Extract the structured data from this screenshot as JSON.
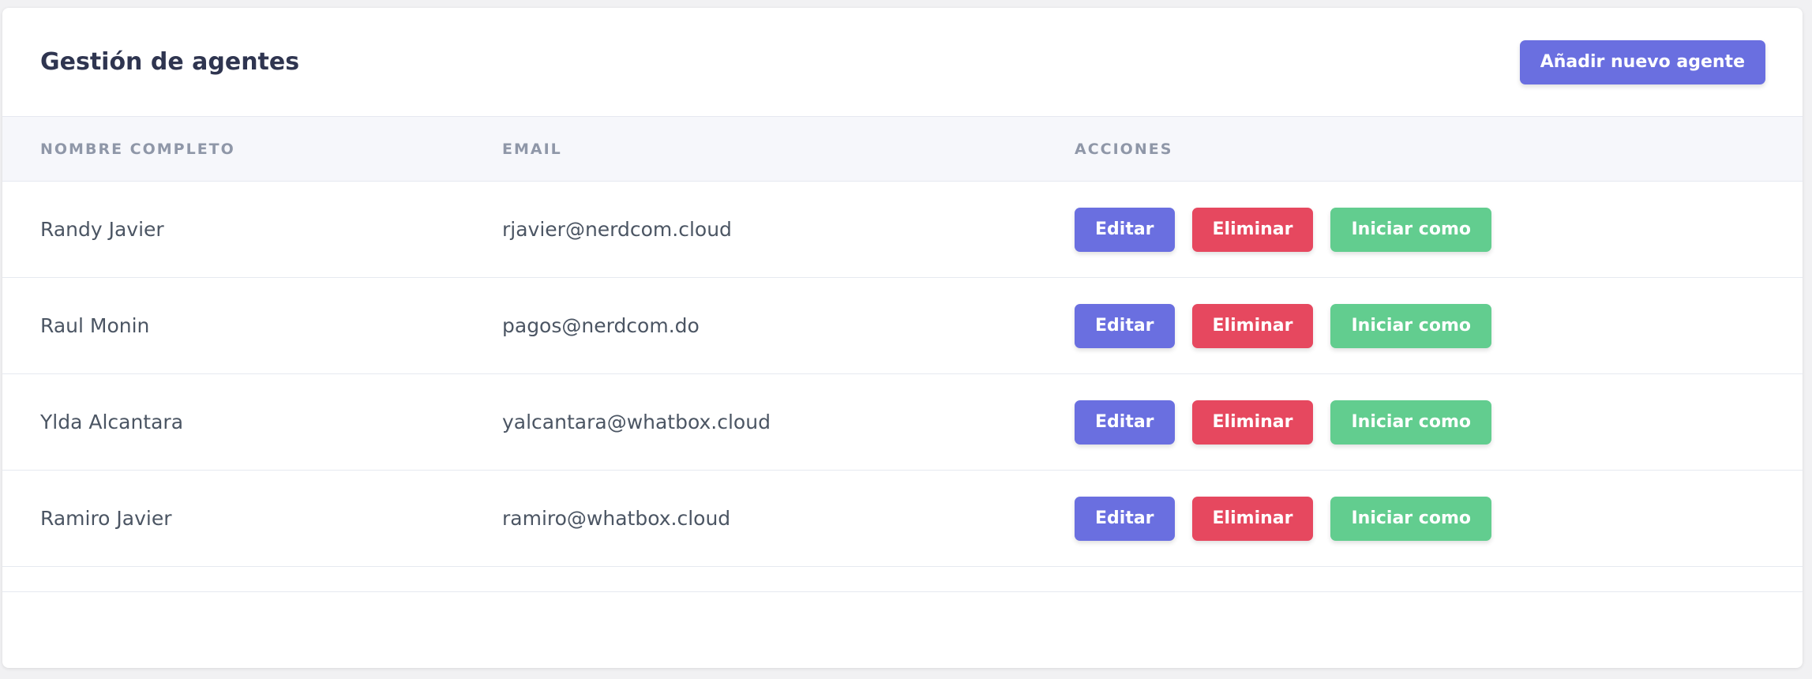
{
  "header": {
    "title": "Gestión de agentes",
    "add_button_label": "Añadir nuevo agente"
  },
  "table": {
    "columns": [
      "NOMBRE COMPLETO",
      "EMAIL",
      "ACCIONES"
    ],
    "rows": [
      {
        "name": "Randy Javier",
        "email": "rjavier@nerdcom.cloud"
      },
      {
        "name": "Raul Monin",
        "email": "pagos@nerdcom.do"
      },
      {
        "name": "Ylda Alcantara",
        "email": "yalcantara@whatbox.cloud"
      },
      {
        "name": "Ramiro Javier",
        "email": "ramiro@whatbox.cloud"
      }
    ],
    "actions": {
      "edit_label": "Editar",
      "delete_label": "Eliminar",
      "login_as_label": "Iniciar como"
    }
  },
  "colors": {
    "primary": "#6a6fe0",
    "danger": "#e6485f",
    "success": "#62cd8f",
    "title_text": "#2f3550",
    "header_bg": "#f6f7fb"
  }
}
